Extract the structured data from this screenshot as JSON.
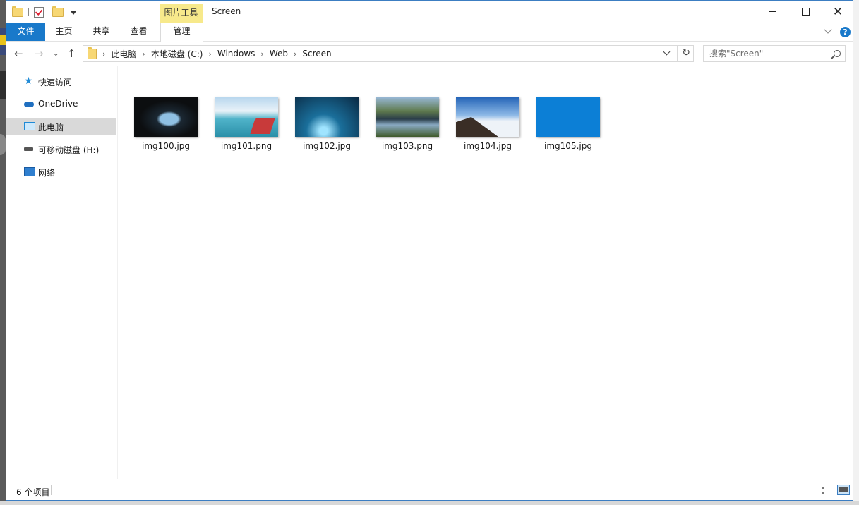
{
  "window": {
    "title": "Screen",
    "context_tab_group": "图片工具"
  },
  "ribbon": {
    "tabs": [
      {
        "label": "文件"
      },
      {
        "label": "主页"
      },
      {
        "label": "共享"
      },
      {
        "label": "查看"
      },
      {
        "label": "管理"
      }
    ],
    "help": "?"
  },
  "address_bar": {
    "breadcrumbs": [
      "此电脑",
      "本地磁盘 (C:)",
      "Windows",
      "Web",
      "Screen"
    ],
    "separator": "›"
  },
  "search": {
    "placeholder": "搜索\"Screen\""
  },
  "nav_pane": {
    "items": [
      {
        "label": "快速访问",
        "icon": "star-icon"
      },
      {
        "label": "OneDrive",
        "icon": "cloud-icon"
      },
      {
        "label": "此电脑",
        "icon": "computer-icon",
        "selected": true
      },
      {
        "label": "可移动磁盘 (H:)",
        "icon": "drive-icon"
      },
      {
        "label": "网络",
        "icon": "network-icon"
      }
    ]
  },
  "files": [
    {
      "name": "img100.jpg"
    },
    {
      "name": "img101.png"
    },
    {
      "name": "img102.jpg"
    },
    {
      "name": "img103.png"
    },
    {
      "name": "img104.jpg"
    },
    {
      "name": "img105.jpg"
    }
  ],
  "status": {
    "item_count": "6 个项目"
  },
  "colors": {
    "accent": "#1979ca",
    "context_tab": "#f7e98b",
    "selection": "#d9d9d9"
  }
}
